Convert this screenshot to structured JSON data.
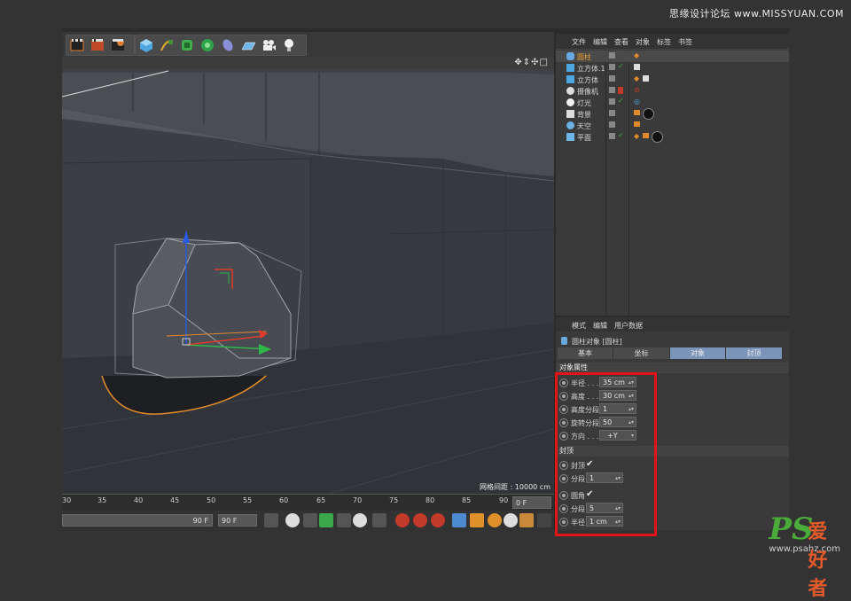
{
  "watermark": {
    "top": "思缘设计论坛 www.MISSYUAN.COM",
    "ps": "PS",
    "cn": "爱好者",
    "url": "www.psahz.com"
  },
  "viewport": {
    "grid_spacing": "网格间距 : 10000 cm",
    "nav_icons": "✥⇕✣□"
  },
  "timeline": {
    "ticks": [
      "30",
      "35",
      "40",
      "45",
      "50",
      "55",
      "60",
      "65",
      "70",
      "75",
      "80",
      "85",
      "90"
    ],
    "end_frame": "0 F"
  },
  "transport": {
    "field_a": "90 F",
    "field_b": "90 F"
  },
  "object_manager": {
    "menu": [
      "文件",
      "编辑",
      "查看",
      "对象",
      "标签",
      "书签"
    ],
    "objects": [
      {
        "name": "圆柱",
        "selected": true
      },
      {
        "name": "立方体.1",
        "selected": false
      },
      {
        "name": "立方体",
        "selected": false
      },
      {
        "name": "摄像机",
        "selected": false
      },
      {
        "name": "灯光",
        "selected": false
      },
      {
        "name": "背景",
        "selected": false
      },
      {
        "name": "天空",
        "selected": false
      },
      {
        "name": "平面",
        "selected": false
      }
    ]
  },
  "attribute_manager": {
    "menu": [
      "模式",
      "编辑",
      "用户数据"
    ],
    "title": "圆柱对象 [圆柱]",
    "tabs": [
      "基本",
      "坐标",
      "对象",
      "封顶"
    ],
    "section_object": "对象属性",
    "params_object": [
      {
        "label": "半径 . . .",
        "value": "35 cm"
      },
      {
        "label": "高度 . . .",
        "value": "30 cm"
      },
      {
        "label": "高度分段",
        "value": "1"
      },
      {
        "label": "旋转分段",
        "value": "50"
      },
      {
        "label": "方向 . . .",
        "value": "+Y"
      }
    ],
    "section_caps": "封顶",
    "caps": {
      "caps_label": "封顶",
      "caps_check": "✔",
      "seg_label": "分段",
      "seg_value": "1",
      "fillet_label": "圆角",
      "fillet_check": "✔",
      "fillet_seg_label": "分段",
      "fillet_seg_value": "5",
      "fillet_rad_label": "半径",
      "fillet_rad_value": "1 cm"
    }
  },
  "colors": {
    "selection_box": "#e3131a",
    "active_tab": "#7a95b8",
    "ps_green": "#4aaa3a",
    "ps_orange": "#e35a2b"
  }
}
